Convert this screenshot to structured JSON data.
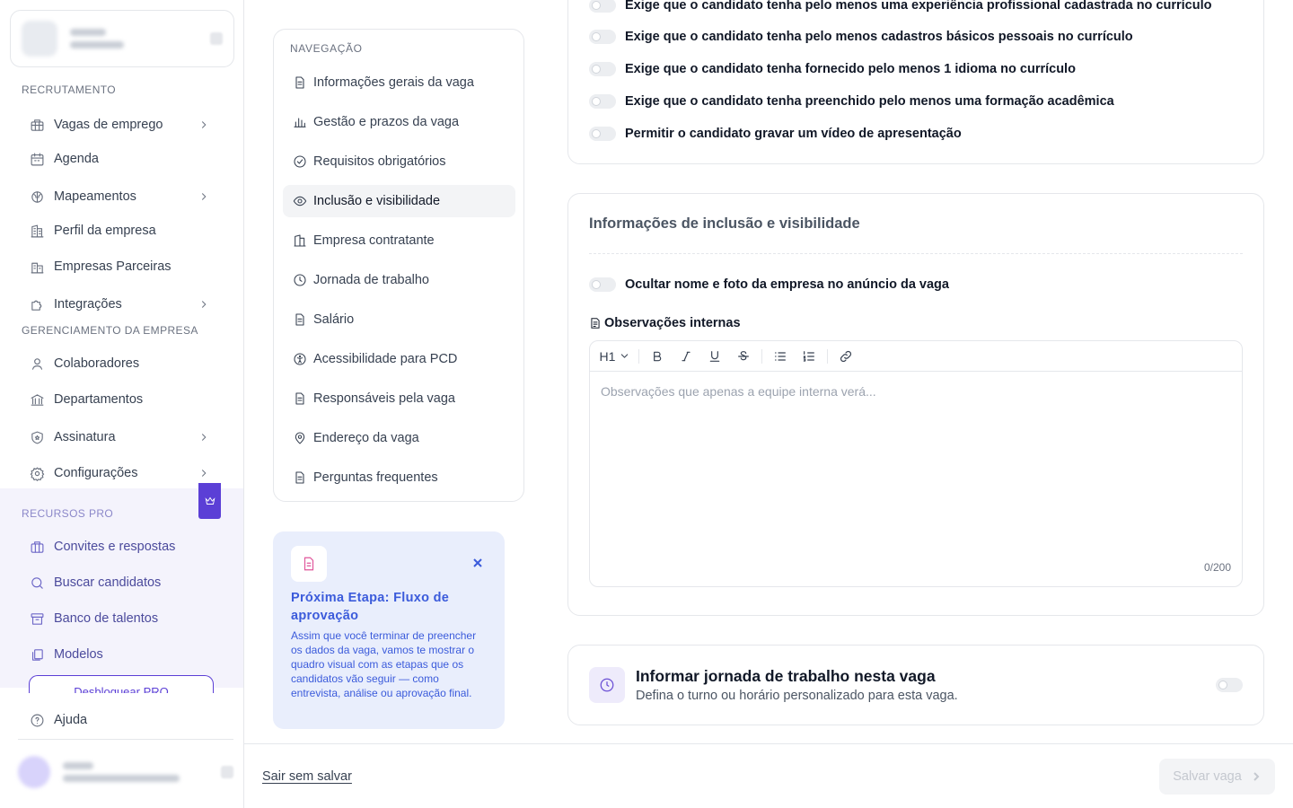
{
  "sidebar": {
    "section_recrutamento": "RECRUTAMENTO",
    "section_gerenciamento": "GERENCIAMENTO DA EMPRESA",
    "section_pro": "RECURSOS PRO",
    "items": {
      "vagas": "Vagas de emprego",
      "agenda": "Agenda",
      "mapeamentos": "Mapeamentos",
      "perfil": "Perfil da empresa",
      "parceiras": "Empresas Parceiras",
      "integracoes": "Integrações",
      "colaboradores": "Colaboradores",
      "departamentos": "Departamentos",
      "assinatura": "Assinatura",
      "configuracoes": "Configurações",
      "convites": "Convites e respostas",
      "buscar": "Buscar candidatos",
      "banco": "Banco de talentos",
      "modelos": "Modelos",
      "ajuda": "Ajuda"
    },
    "pro_cta": "Desbloquear PRO"
  },
  "subnav": {
    "title": "NAVEGAÇÃO",
    "items": [
      "Informações gerais da vaga",
      "Gestão e prazos da vaga",
      "Requisitos obrigatórios",
      "Inclusão e visibilidade",
      "Empresa contratante",
      "Jornada de trabalho",
      "Salário",
      "Acessibilidade para PCD",
      "Responsáveis pela vaga",
      "Endereço da vaga",
      "Perguntas frequentes"
    ],
    "active_index": 3
  },
  "next_step": {
    "title": "Próxima Etapa: Fluxo de aprovação",
    "text": "Assim que você terminar de preencher os dados da vaga, vamos te mostrar o quadro visual com as etapas que os candidatos vão seguir — como entrevista, análise ou aprovação final."
  },
  "requirements": {
    "toggles": [
      "Exige que o candidato tenha pelo menos uma experiência profissional cadastrada no currículo",
      "Exige que o candidato tenha pelo menos cadastros básicos pessoais no currículo",
      "Exige que o candidato tenha fornecido pelo menos 1 idioma no currículo",
      "Exige que o candidato tenha preenchido pelo menos uma formação acadêmica",
      "Permitir o candidato gravar um vídeo de apresentação"
    ]
  },
  "inclusion": {
    "title": "Informações de inclusão e visibilidade",
    "hide_toggle": "Ocultar nome e foto da empresa no anúncio da vaga",
    "notes_label": "Observações internas",
    "heading_select": "H1",
    "placeholder": "Observações que apenas a equipe interna verá...",
    "counter": "0/200"
  },
  "jornada": {
    "title": "Informar jornada de trabalho nesta vaga",
    "description": "Defina o turno ou horário personalizado para esta vaga."
  },
  "footer": {
    "exit": "Sair sem salvar",
    "save": "Salvar vaga"
  },
  "colors": {
    "accent": "#5b3fd6",
    "pro_bg": "#f4f3fc",
    "info_blue": "#3b5bdb",
    "info_bg": "#e9eefc"
  }
}
